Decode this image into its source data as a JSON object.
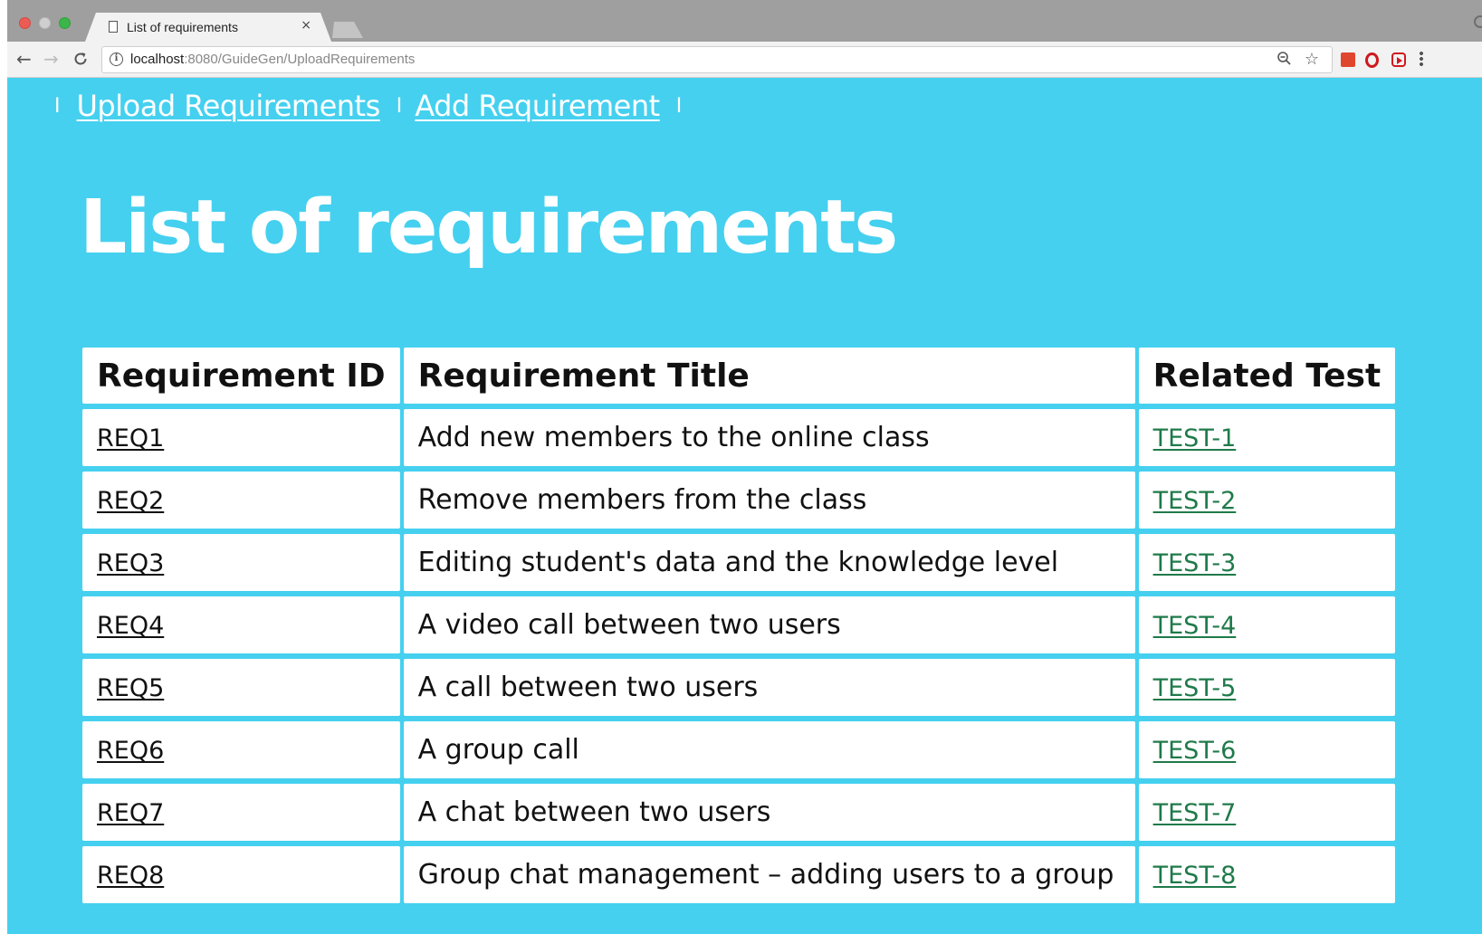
{
  "browser": {
    "tab_title": "List of requirements",
    "tab_close": "×",
    "url_host": "localhost",
    "url_rest": ":8080/GuideGen/UploadRequirements",
    "icons": {
      "back": "←",
      "forward": "→",
      "reload": "C",
      "info": "i",
      "zoom": "⊖",
      "star": "☆"
    }
  },
  "nav": {
    "separator": "I",
    "links": [
      {
        "label": "Upload Requirements"
      },
      {
        "label": "Add Requirement"
      }
    ]
  },
  "page": {
    "title": "List of requirements",
    "background": "#45d0ef"
  },
  "table": {
    "headers": [
      "Requirement ID",
      "Requirement Title",
      "Related Test"
    ],
    "rows": [
      {
        "id": "REQ1",
        "title": "Add new members to the online class",
        "test": "TEST-1"
      },
      {
        "id": "REQ2",
        "title": "Remove members from the class",
        "test": "TEST-2"
      },
      {
        "id": "REQ3",
        "title": "Editing student's data and the knowledge level",
        "test": "TEST-3"
      },
      {
        "id": "REQ4",
        "title": "A video call between two users",
        "test": "TEST-4"
      },
      {
        "id": "REQ5",
        "title": "A call between two users",
        "test": "TEST-5"
      },
      {
        "id": "REQ6",
        "title": "A group call",
        "test": "TEST-6"
      },
      {
        "id": "REQ7",
        "title": "A chat between two users",
        "test": "TEST-7"
      },
      {
        "id": "REQ8",
        "title": "Group chat management – adding users to a group",
        "test": "TEST-8"
      }
    ]
  },
  "colors": {
    "test_link": "#1f7a4a",
    "text": "#111111"
  }
}
